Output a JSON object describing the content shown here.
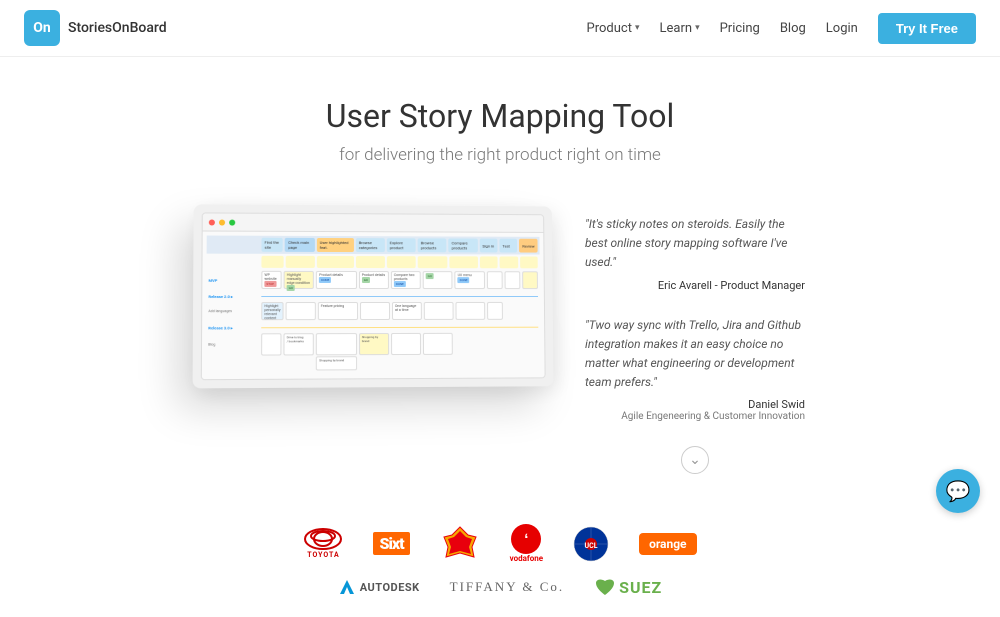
{
  "nav": {
    "logo_text": "StoriesOnBoard",
    "logo_abbr": "On",
    "links": [
      {
        "label": "Product",
        "has_chevron": true
      },
      {
        "label": "Learn",
        "has_chevron": true
      },
      {
        "label": "Pricing",
        "has_chevron": false
      },
      {
        "label": "Blog",
        "has_chevron": false
      },
      {
        "label": "Login",
        "has_chevron": false
      }
    ],
    "cta_label": "Try It Free"
  },
  "hero": {
    "title": "User Story Mapping Tool",
    "subtitle": "for delivering the right product right on time"
  },
  "reviews": [
    {
      "text": "\"It's sticky notes on steroids. Easily the best online story mapping software I've used.\"",
      "author": "Eric Avarell - Product Manager"
    },
    {
      "text": "\"Two way sync with Trello, Jira and Github integration makes it an easy choice no matter what engineering or development team prefers.\"",
      "author": "Daniel Swid",
      "title": "Agile Engeneering & Customer Innovation"
    }
  ],
  "logos": {
    "row1": [
      "toyota",
      "sixt",
      "shell",
      "vodafone",
      "ucl",
      "orange"
    ],
    "row2": [
      "autodesk",
      "tiffany",
      "suez"
    ]
  },
  "story_map": {
    "epics": [
      "Find the site",
      "Check main page",
      "User highlighted features",
      "Browse categories",
      "Explore product",
      "Browse products",
      "Compare products",
      "Sign in",
      "Test",
      "Review"
    ],
    "releases": [
      "MVP",
      "Release 2.0",
      "Release 3.0"
    ]
  }
}
